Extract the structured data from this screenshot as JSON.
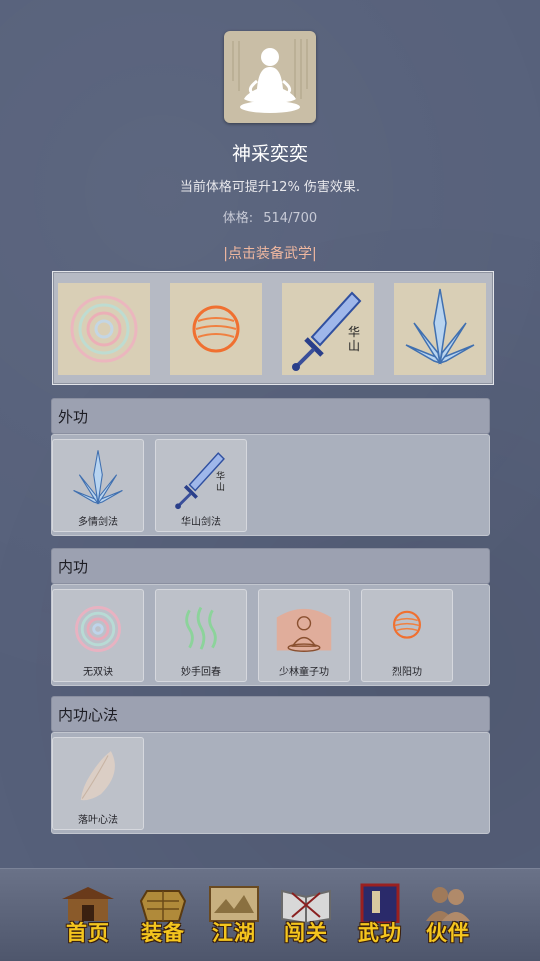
{
  "profile": {
    "title": "神采奕奕",
    "description": "当前体格可提升12% 伤害效果.",
    "stat_label": "体格:",
    "stat_value": "514/700",
    "equip_prompt": "|点击装备武学|"
  },
  "equipped_slots": [
    {
      "icon": "spiral-swirl-icon"
    },
    {
      "icon": "orange-orb-icon"
    },
    {
      "icon": "huashan-sword-icon",
      "text": "华山"
    },
    {
      "icon": "crystal-blades-icon"
    }
  ],
  "sections": [
    {
      "title": "外功",
      "items": [
        {
          "label": "多情剑法",
          "icon": "crystal-blades-icon"
        },
        {
          "label": "华山剑法",
          "icon": "huashan-sword-icon",
          "text": "华山"
        }
      ]
    },
    {
      "title": "内功",
      "items": [
        {
          "label": "无双诀",
          "icon": "spiral-swirl-icon"
        },
        {
          "label": "妙手回春",
          "icon": "green-waves-icon"
        },
        {
          "label": "少林童子功",
          "icon": "meditating-monk-icon"
        },
        {
          "label": "烈阳功",
          "icon": "orange-orb-icon"
        }
      ]
    },
    {
      "title": "内功心法",
      "items": [
        {
          "label": "落叶心法",
          "icon": "feather-leaf-icon"
        }
      ]
    }
  ],
  "tabs": [
    {
      "label": "首页",
      "icon": "house-icon"
    },
    {
      "label": "装备",
      "icon": "armor-icon"
    },
    {
      "label": "江湖",
      "icon": "scroll-map-icon"
    },
    {
      "label": "闯关",
      "icon": "open-book-icon"
    },
    {
      "label": "武功",
      "icon": "martial-book-icon"
    },
    {
      "label": "伙伴",
      "icon": "companions-icon"
    }
  ]
}
